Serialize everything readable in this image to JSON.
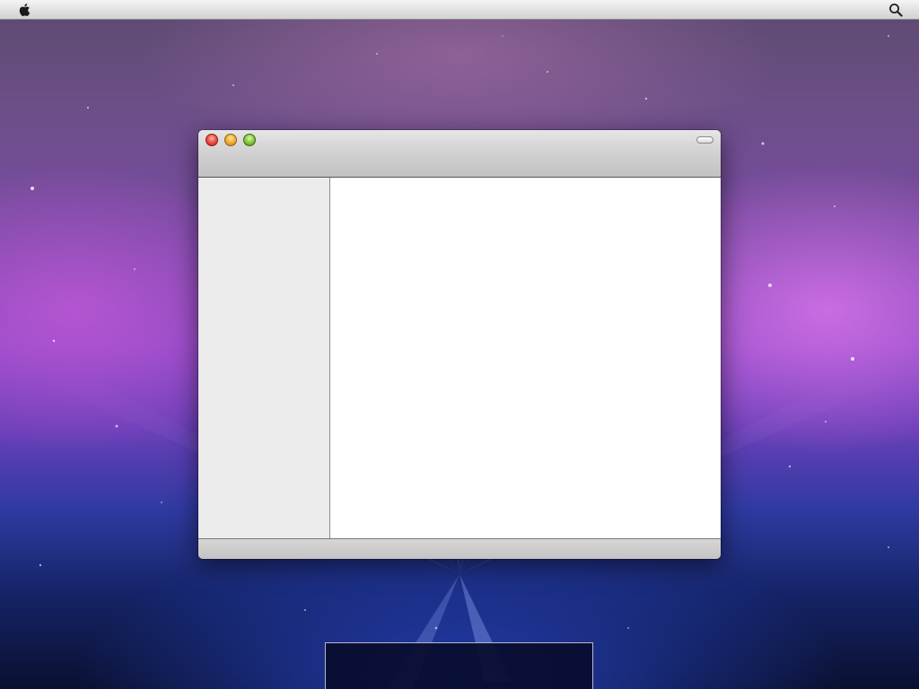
{
  "menubar": {
    "apple_menu_icon": "apple-logo-icon",
    "spotlight_icon": "search-icon"
  },
  "window": {
    "controls": {
      "close": {
        "icon": "close-icon",
        "color": "#f0564a"
      },
      "minimize": {
        "icon": "minimize-icon",
        "color": "#f5b43a"
      },
      "zoom": {
        "icon": "zoom-icon",
        "color": "#8fce4a"
      }
    },
    "toolbar_toggle_icon": "toolbar-toggle-icon"
  },
  "colors": {
    "sidebar_bg": "#ebebeb",
    "content_bg": "#ffffff",
    "dock_bg": "#080c2d"
  }
}
